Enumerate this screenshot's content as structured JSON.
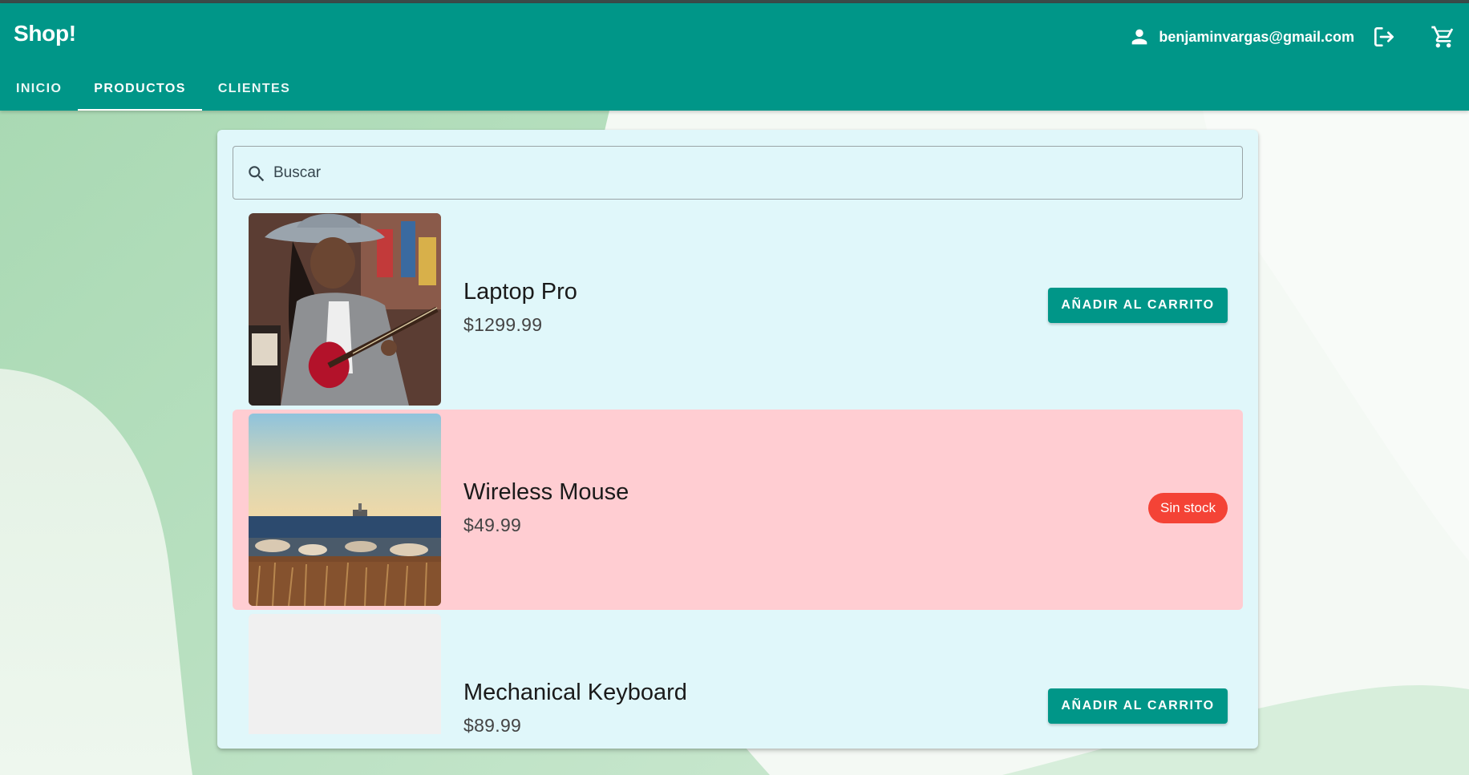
{
  "app": {
    "brand": "Shop!"
  },
  "user": {
    "email": "benjaminvargas@gmail.com"
  },
  "icons": {
    "user": "person-icon",
    "logout": "logout-icon",
    "cart": "shopping-cart-icon",
    "search": "search-icon"
  },
  "tabs": [
    {
      "label": "INICIO",
      "active": false
    },
    {
      "label": "PRODUCTOS",
      "active": true
    },
    {
      "label": "CLIENTES",
      "active": false
    }
  ],
  "search": {
    "placeholder": "Buscar",
    "value": ""
  },
  "products": [
    {
      "name": "Laptop Pro",
      "price": "$1299.99",
      "action": "AÑADIR AL CARRITO",
      "in_stock": true
    },
    {
      "name": "Wireless Mouse",
      "price": "$49.99",
      "status": "Sin stock",
      "in_stock": false
    },
    {
      "name": "Mechanical Keyboard",
      "price": "$89.99",
      "action": "AÑADIR AL CARRITO",
      "in_stock": true
    }
  ],
  "colors": {
    "primary": "#009688",
    "card": "#e0f7fa",
    "out_of_stock_row": "#ffcdd2",
    "out_of_stock_chip": "#f44336"
  }
}
